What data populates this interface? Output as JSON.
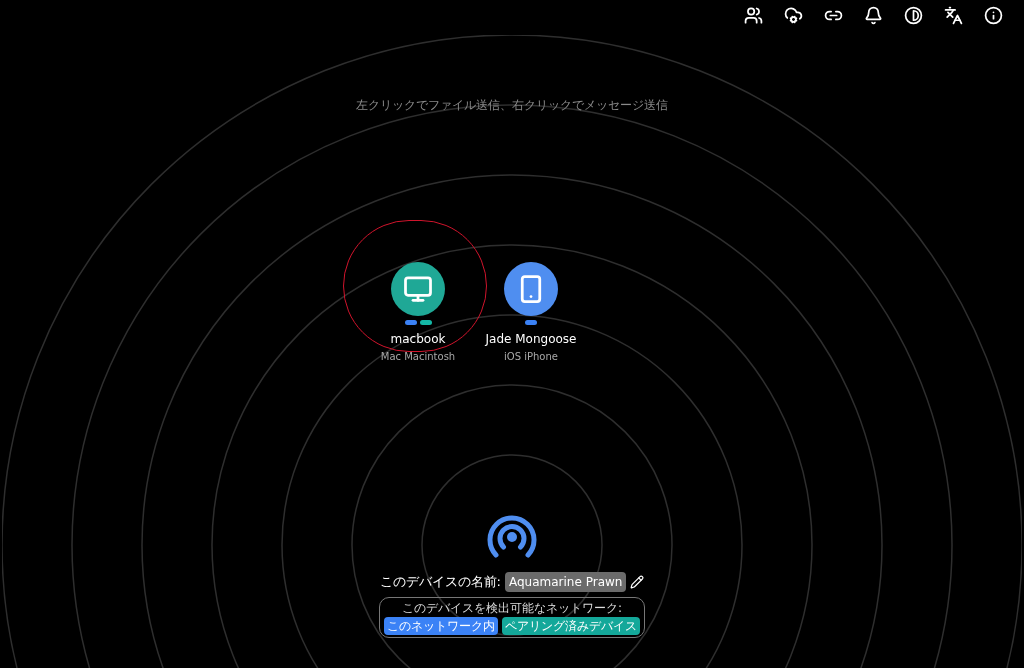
{
  "toolbar": [
    {
      "kind": "users"
    },
    {
      "kind": "cloud-gear"
    },
    {
      "kind": "link"
    },
    {
      "kind": "bell"
    },
    {
      "kind": "contrast"
    },
    {
      "kind": "language"
    },
    {
      "kind": "info"
    }
  ],
  "hint": "左クリックでファイル送信、右クリックでメッセージ送信",
  "devices": [
    {
      "name": "macbook",
      "type": "Mac Macintosh",
      "kind": "desktop",
      "color": "#1fa896",
      "selected": true,
      "dots": [
        {
          "color": "#3b82f6"
        },
        {
          "color": "#14b8a6"
        }
      ]
    },
    {
      "name": "Jade Mongoose",
      "type": "iOS iPhone",
      "kind": "phone",
      "color": "#4f8ef0",
      "selected": false,
      "dots": [
        {
          "color": "#3b82f6"
        }
      ]
    }
  ],
  "device_name": {
    "label": "このデバイスの名前:",
    "value": "Aquamarine Prawn"
  },
  "networks": {
    "label": "このデバイスを検出可能なネットワーク:",
    "items": [
      {
        "label": "このネットワーク内",
        "color": "#3b82f6"
      },
      {
        "label": "ペアリング済みデバイス",
        "color": "#14a89a"
      }
    ]
  }
}
